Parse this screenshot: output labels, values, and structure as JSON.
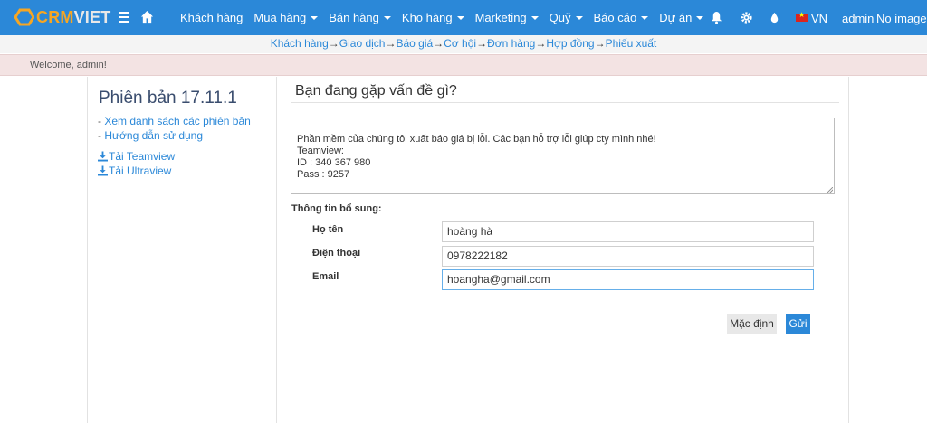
{
  "brand": {
    "name_part1": "CRM",
    "name_part2": "VIET",
    "accent": "#f6a623",
    "nav_color": "#2b88d8"
  },
  "nav": {
    "menu": [
      {
        "label": "Khách hàng",
        "dropdown": false
      },
      {
        "label": "Mua hàng",
        "dropdown": true
      },
      {
        "label": "Bán hàng",
        "dropdown": true
      },
      {
        "label": "Kho hàng",
        "dropdown": true
      },
      {
        "label": "Marketing",
        "dropdown": true
      },
      {
        "label": "Quỹ",
        "dropdown": true
      },
      {
        "label": "Báo cáo",
        "dropdown": true
      },
      {
        "label": "Dự án",
        "dropdown": true
      }
    ],
    "icons": [
      "menu-icon",
      "home-icon",
      "bell-icon",
      "gear-icon",
      "drop-icon"
    ],
    "language": "VN",
    "user": "admin",
    "avatar": "No image"
  },
  "flow": [
    "Khách hàng",
    "Giao dịch",
    "Báo giá",
    "Cơ hội",
    "Đơn hàng",
    "Hợp đồng",
    "Phiếu xuất"
  ],
  "flow_arrow": "→",
  "welcome": "Welcome, admin!",
  "sidebar": {
    "version": "Phiên bản 17.11.1",
    "links": [
      {
        "prefix": "- ",
        "label": "Xem danh sách các phiên bản"
      },
      {
        "prefix": "- ",
        "label": "Hướng dẫn sử dụng"
      }
    ],
    "downloads": [
      "Tải Teamview",
      "Tải Ultraview"
    ]
  },
  "form": {
    "title": "Bạn đang gặp vấn đề gì?",
    "message": "Phần mềm của chúng tôi xuất báo giá bị lỗi. Các bạn hỗ trợ lỗi giúp cty mình nhé!\nTeamview:\nID : 340 367 980\nPass : 9257",
    "section_label": "Thông tin bổ sung:",
    "fields": [
      {
        "label": "Họ tên",
        "value": "hoàng hà"
      },
      {
        "label": "Điện thoại",
        "value": "0978222182"
      },
      {
        "label": "Email",
        "value": "hoangha@gmail.com"
      }
    ],
    "reset_label": "Mặc định",
    "submit_label": "Gửi"
  }
}
